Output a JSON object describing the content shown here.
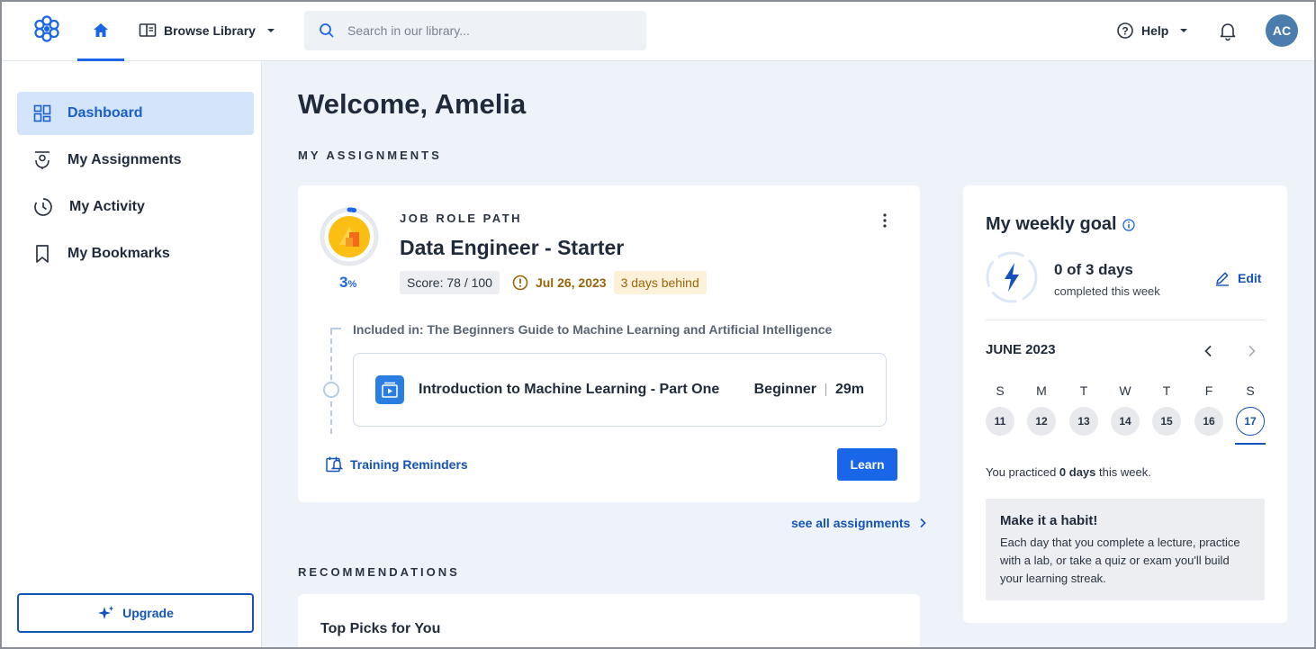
{
  "header": {
    "browse_label": "Browse Library",
    "search_placeholder": "Search in our library...",
    "help_label": "Help",
    "avatar_initials": "AC"
  },
  "sidebar": {
    "items": [
      {
        "label": "Dashboard",
        "icon": "dashboard-icon",
        "active": true
      },
      {
        "label": "My Assignments",
        "icon": "assignments-icon"
      },
      {
        "label": "My Activity",
        "icon": "activity-icon"
      },
      {
        "label": "My Bookmarks",
        "icon": "bookmark-icon"
      }
    ],
    "upgrade_label": "Upgrade"
  },
  "main": {
    "welcome": "Welcome, Amelia",
    "assignments_heading": "MY ASSIGNMENTS",
    "assignment": {
      "kicker": "JOB ROLE PATH",
      "title": "Data Engineer - Starter",
      "progress_value": "3",
      "progress_unit": "%",
      "progress_fraction": 0.03,
      "score": "Score: 78 / 100",
      "due_date": "Jul 26, 2023",
      "behind": "3 days behind",
      "included_in": "Included in: The Beginners Guide to Machine Learning and Artificial Intelligence",
      "course": {
        "title": "Introduction to Machine Learning - Part One",
        "level": "Beginner",
        "duration": "29m"
      },
      "reminders_label": "Training Reminders",
      "learn_label": "Learn"
    },
    "see_all_label": "see all assignments",
    "recommendations_heading": "RECOMMENDATIONS",
    "top_picks": "Top Picks for You"
  },
  "goal": {
    "title": "My weekly goal",
    "days": "0 of 3 days",
    "sub": "completed this week",
    "edit_label": "Edit",
    "month": "JUNE 2023",
    "weekdays": [
      "S",
      "M",
      "T",
      "W",
      "T",
      "F",
      "S"
    ],
    "days_list": [
      "11",
      "12",
      "13",
      "14",
      "15",
      "16",
      "17"
    ],
    "practiced_prefix": "You practiced ",
    "practiced_bold": "0 days",
    "practiced_suffix": " this week.",
    "habit_title": "Make it a habit!",
    "habit_text": "Each day that you complete a lecture, practice with a lab, or take a quiz or exam you'll build your learning streak."
  },
  "colors": {
    "accent": "#1a66e8",
    "accent_dark": "#1553b8",
    "warning": "#9a6508",
    "active_nav_bg": "#d4e4fb"
  }
}
